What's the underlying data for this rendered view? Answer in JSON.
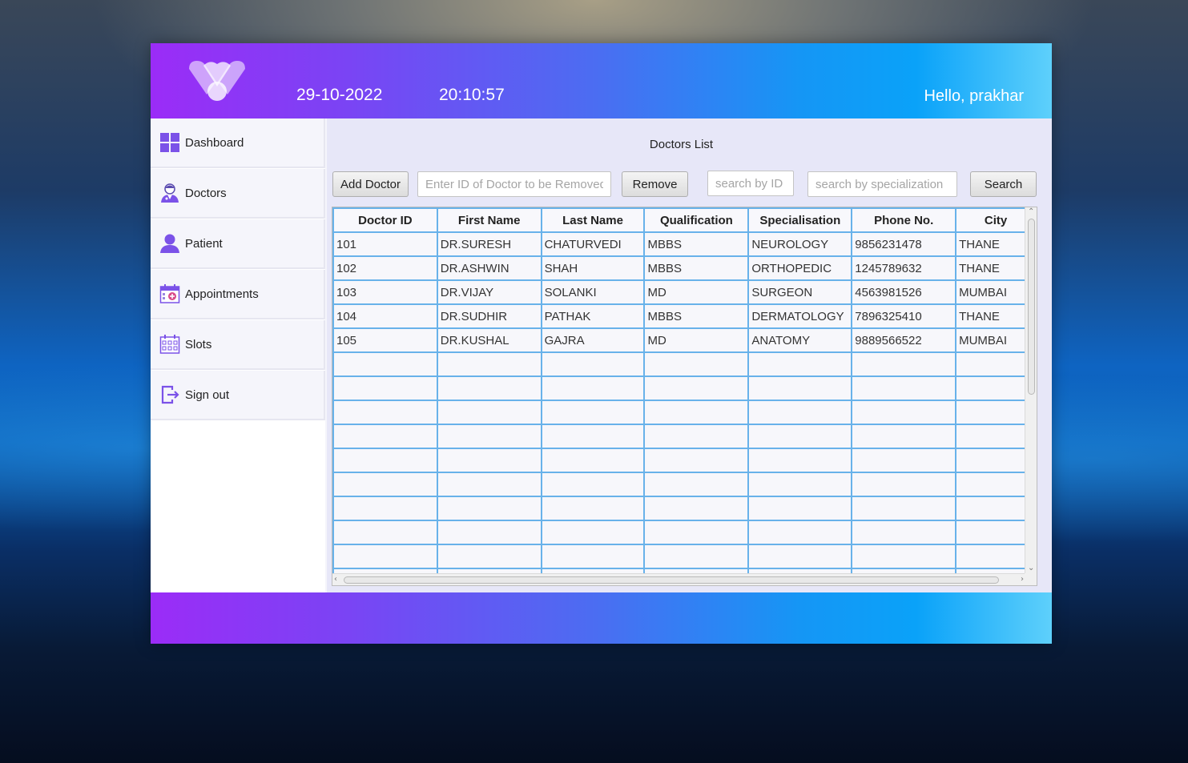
{
  "header": {
    "date": "29-10-2022",
    "time": "20:10:57",
    "greeting": "Hello, prakhar"
  },
  "sidebar": {
    "items": [
      {
        "label": "Dashboard",
        "icon": "dashboard-grid-icon"
      },
      {
        "label": "Doctors",
        "icon": "doctor-icon"
      },
      {
        "label": "Patient",
        "icon": "user-icon"
      },
      {
        "label": "Appointments",
        "icon": "calendar-plus-icon"
      },
      {
        "label": "Slots",
        "icon": "calendar-grid-icon"
      },
      {
        "label": "Sign out",
        "icon": "sign-out-icon"
      }
    ]
  },
  "main": {
    "title": "Doctors List",
    "add_button": "Add Doctor",
    "remove_input_placeholder": "Enter ID of Doctor to be Removed",
    "remove_button": "Remove",
    "search_id_placeholder": "search by ID",
    "search_spec_placeholder": "search by specialization",
    "search_button": "Search"
  },
  "table": {
    "columns": [
      "Doctor ID",
      "First Name",
      "Last Name",
      "Qualification",
      "Specialisation",
      "Phone No.",
      "City"
    ],
    "rows": [
      [
        "101",
        "DR.SURESH",
        "CHATURVEDI",
        "MBBS",
        "NEUROLOGY",
        "9856231478",
        "THANE"
      ],
      [
        "102",
        "DR.ASHWIN",
        "SHAH",
        "MBBS",
        "ORTHOPEDIC",
        "1245789632",
        "THANE"
      ],
      [
        "103",
        "DR.VIJAY",
        "SOLANKI",
        "MD",
        "SURGEON",
        "4563981526",
        "MUMBAI"
      ],
      [
        "104",
        "DR.SUDHIR",
        "PATHAK",
        "MBBS",
        "DERMATOLOGY",
        "7896325410",
        "THANE"
      ],
      [
        "105",
        "DR.KUSHAL",
        "GAJRA",
        "MD",
        "ANATOMY",
        "9889566522",
        "MUMBAI"
      ]
    ]
  },
  "colors": {
    "gradient_start": "#9b2cf7",
    "gradient_end": "#5ed0fb",
    "accent_purple": "#7b52e8",
    "grid_line": "#68b2ea"
  }
}
